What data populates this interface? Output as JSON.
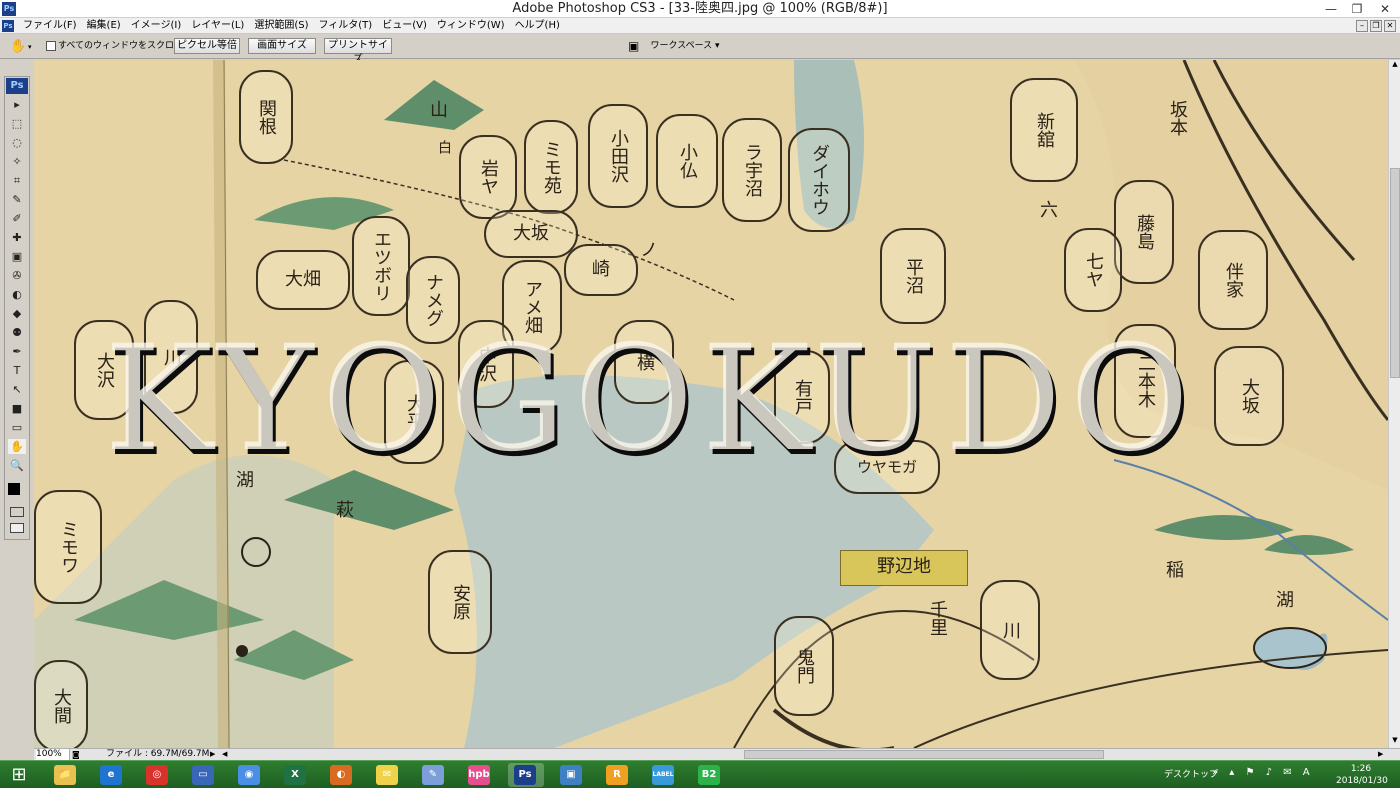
{
  "window": {
    "title": "Adobe Photoshop CS3 - [33-陸奥四.jpg @ 100% (RGB/8#)]",
    "logo": "Ps",
    "controls": [
      "minimize-icon",
      "restore-icon",
      "close-icon"
    ],
    "controls_glyphs": {
      "minimize": "—",
      "restore": "❐",
      "close": "✕"
    }
  },
  "menubar": {
    "logo": "Ps",
    "items": [
      "ファイル(F)",
      "編集(E)",
      "イメージ(I)",
      "レイヤー(L)",
      "選択範囲(S)",
      "フィルタ(T)",
      "ビュー(V)",
      "ウィンドウ(W)",
      "ヘルプ(H)"
    ],
    "doc_controls": {
      "minimize": "–",
      "restore": "❐",
      "close": "✕"
    }
  },
  "options_bar": {
    "hand_icon": "✋",
    "scroll_all_label": "すべてのウィンドウをスクロール",
    "actual_pixels": "ピクセル等倍",
    "fit_screen": "画面サイズ",
    "print_size": "プリントサイズ",
    "workspace": "ワークスペース ▾"
  },
  "toolbox": {
    "logo": "Ps",
    "tools": [
      "▸",
      "⬚",
      "◌",
      "✧",
      "⌗",
      "✎",
      "✐",
      "✚",
      "▣",
      "✇",
      "◐",
      "◆",
      "⚉",
      "✒",
      "T",
      "↖",
      "■",
      "▭",
      "✋",
      "🔍"
    ],
    "tool_names": [
      "move-tool-icon",
      "marquee-tool-icon",
      "lasso-tool-icon",
      "magic-wand-icon",
      "crop-tool-icon",
      "slice-tool-icon",
      "healing-brush-icon",
      "brush-tool-icon",
      "clone-stamp-icon",
      "history-brush-icon",
      "eraser-tool-icon",
      "gradient-tool-icon",
      "dodge-tool-icon",
      "pen-tool-icon",
      "type-tool-icon",
      "path-selection-icon",
      "shape-tool-icon",
      "notes-tool-icon",
      "hand-tool-icon",
      "zoom-tool-icon"
    ]
  },
  "canvas": {
    "watermark": "KYOGOKUDO",
    "marks": [
      "関根",
      "山",
      "白",
      "岩ヤ",
      "ミモ苑",
      "小田沢",
      "小仏",
      "ラ宇沼",
      "ダイホウ",
      "大坂",
      "大畑",
      "エツボリ",
      "ナメグ",
      "アメ畑",
      "崎",
      "ノ",
      "平沼",
      "新舘",
      "坂本",
      "藤島",
      "七ヤ",
      "六",
      "伴家",
      "二本木",
      "大坂",
      "中沢",
      "大平",
      "横",
      "有戸",
      "ウヤモガ",
      "川",
      "大沢",
      "ミモワ",
      "湖",
      "安原",
      "萩",
      "大間",
      "鬼門",
      "川",
      "千里",
      "稲",
      "湖",
      "野辺地"
    ],
    "label": "野辺地",
    "lake_label": "湖",
    "rice_label": "稲"
  },
  "statusbar": {
    "zoom": "100%",
    "file_info": "ファイル : 69.7M/69.7M"
  },
  "taskbar": {
    "start": "⊞",
    "apps": [
      {
        "name": "file-explorer",
        "label": "📁",
        "color": "#e9c150"
      },
      {
        "name": "internet-explorer",
        "label": "e",
        "color": "#1f74d1"
      },
      {
        "name": "app-red",
        "label": "◎",
        "color": "#d9322b"
      },
      {
        "name": "app-blue",
        "label": "▭",
        "color": "#3a66b8"
      },
      {
        "name": "chrome",
        "label": "◉",
        "color": "#4b8ee6"
      },
      {
        "name": "excel",
        "label": "X",
        "color": "#1f7244"
      },
      {
        "name": "firefox",
        "label": "◐",
        "color": "#d96a21"
      },
      {
        "name": "notes",
        "label": "✉",
        "color": "#f0d24a"
      },
      {
        "name": "paint",
        "label": "✎",
        "color": "#7d9ed8"
      },
      {
        "name": "hpb",
        "label": "hpb",
        "color": "#e64e8e"
      },
      {
        "name": "photoshop",
        "label": "Ps",
        "color": "#1c3f8a"
      },
      {
        "name": "photos",
        "label": "▣",
        "color": "#3f7fc4"
      },
      {
        "name": "app-r",
        "label": "R",
        "color": "#f0a020"
      },
      {
        "name": "label-app",
        "label": "LABEL",
        "color": "#3a9ad9"
      },
      {
        "name": "b2",
        "label": "B2",
        "color": "#2bb34a"
      }
    ],
    "desktop": "デスクトップ",
    "tray": "» ▴ ⚑ ♪ ✉ A",
    "time": "1:26",
    "date": "2018/01/30"
  },
  "colors": {
    "parchment": "#e8d6a8",
    "ink": "#2a2218",
    "water": "#b9c8c2",
    "taskbar": "#226a28",
    "ps_blue": "#1c3f8a"
  }
}
